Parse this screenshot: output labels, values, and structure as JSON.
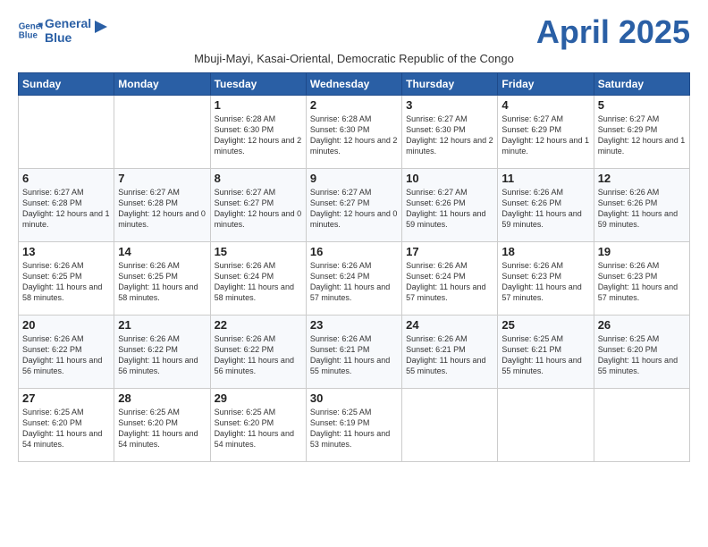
{
  "logo": {
    "line1": "General",
    "line2": "Blue"
  },
  "title": "April 2025",
  "subtitle": "Mbuji-Mayi, Kasai-Oriental, Democratic Republic of the Congo",
  "days_of_week": [
    "Sunday",
    "Monday",
    "Tuesday",
    "Wednesday",
    "Thursday",
    "Friday",
    "Saturday"
  ],
  "weeks": [
    [
      {
        "day": "",
        "info": ""
      },
      {
        "day": "",
        "info": ""
      },
      {
        "day": "1",
        "info": "Sunrise: 6:28 AM\nSunset: 6:30 PM\nDaylight: 12 hours and 2 minutes."
      },
      {
        "day": "2",
        "info": "Sunrise: 6:28 AM\nSunset: 6:30 PM\nDaylight: 12 hours and 2 minutes."
      },
      {
        "day": "3",
        "info": "Sunrise: 6:27 AM\nSunset: 6:30 PM\nDaylight: 12 hours and 2 minutes."
      },
      {
        "day": "4",
        "info": "Sunrise: 6:27 AM\nSunset: 6:29 PM\nDaylight: 12 hours and 1 minute."
      },
      {
        "day": "5",
        "info": "Sunrise: 6:27 AM\nSunset: 6:29 PM\nDaylight: 12 hours and 1 minute."
      }
    ],
    [
      {
        "day": "6",
        "info": "Sunrise: 6:27 AM\nSunset: 6:28 PM\nDaylight: 12 hours and 1 minute."
      },
      {
        "day": "7",
        "info": "Sunrise: 6:27 AM\nSunset: 6:28 PM\nDaylight: 12 hours and 0 minutes."
      },
      {
        "day": "8",
        "info": "Sunrise: 6:27 AM\nSunset: 6:27 PM\nDaylight: 12 hours and 0 minutes."
      },
      {
        "day": "9",
        "info": "Sunrise: 6:27 AM\nSunset: 6:27 PM\nDaylight: 12 hours and 0 minutes."
      },
      {
        "day": "10",
        "info": "Sunrise: 6:27 AM\nSunset: 6:26 PM\nDaylight: 11 hours and 59 minutes."
      },
      {
        "day": "11",
        "info": "Sunrise: 6:26 AM\nSunset: 6:26 PM\nDaylight: 11 hours and 59 minutes."
      },
      {
        "day": "12",
        "info": "Sunrise: 6:26 AM\nSunset: 6:26 PM\nDaylight: 11 hours and 59 minutes."
      }
    ],
    [
      {
        "day": "13",
        "info": "Sunrise: 6:26 AM\nSunset: 6:25 PM\nDaylight: 11 hours and 58 minutes."
      },
      {
        "day": "14",
        "info": "Sunrise: 6:26 AM\nSunset: 6:25 PM\nDaylight: 11 hours and 58 minutes."
      },
      {
        "day": "15",
        "info": "Sunrise: 6:26 AM\nSunset: 6:24 PM\nDaylight: 11 hours and 58 minutes."
      },
      {
        "day": "16",
        "info": "Sunrise: 6:26 AM\nSunset: 6:24 PM\nDaylight: 11 hours and 57 minutes."
      },
      {
        "day": "17",
        "info": "Sunrise: 6:26 AM\nSunset: 6:24 PM\nDaylight: 11 hours and 57 minutes."
      },
      {
        "day": "18",
        "info": "Sunrise: 6:26 AM\nSunset: 6:23 PM\nDaylight: 11 hours and 57 minutes."
      },
      {
        "day": "19",
        "info": "Sunrise: 6:26 AM\nSunset: 6:23 PM\nDaylight: 11 hours and 57 minutes."
      }
    ],
    [
      {
        "day": "20",
        "info": "Sunrise: 6:26 AM\nSunset: 6:22 PM\nDaylight: 11 hours and 56 minutes."
      },
      {
        "day": "21",
        "info": "Sunrise: 6:26 AM\nSunset: 6:22 PM\nDaylight: 11 hours and 56 minutes."
      },
      {
        "day": "22",
        "info": "Sunrise: 6:26 AM\nSunset: 6:22 PM\nDaylight: 11 hours and 56 minutes."
      },
      {
        "day": "23",
        "info": "Sunrise: 6:26 AM\nSunset: 6:21 PM\nDaylight: 11 hours and 55 minutes."
      },
      {
        "day": "24",
        "info": "Sunrise: 6:26 AM\nSunset: 6:21 PM\nDaylight: 11 hours and 55 minutes."
      },
      {
        "day": "25",
        "info": "Sunrise: 6:25 AM\nSunset: 6:21 PM\nDaylight: 11 hours and 55 minutes."
      },
      {
        "day": "26",
        "info": "Sunrise: 6:25 AM\nSunset: 6:20 PM\nDaylight: 11 hours and 55 minutes."
      }
    ],
    [
      {
        "day": "27",
        "info": "Sunrise: 6:25 AM\nSunset: 6:20 PM\nDaylight: 11 hours and 54 minutes."
      },
      {
        "day": "28",
        "info": "Sunrise: 6:25 AM\nSunset: 6:20 PM\nDaylight: 11 hours and 54 minutes."
      },
      {
        "day": "29",
        "info": "Sunrise: 6:25 AM\nSunset: 6:20 PM\nDaylight: 11 hours and 54 minutes."
      },
      {
        "day": "30",
        "info": "Sunrise: 6:25 AM\nSunset: 6:19 PM\nDaylight: 11 hours and 53 minutes."
      },
      {
        "day": "",
        "info": ""
      },
      {
        "day": "",
        "info": ""
      },
      {
        "day": "",
        "info": ""
      }
    ]
  ]
}
